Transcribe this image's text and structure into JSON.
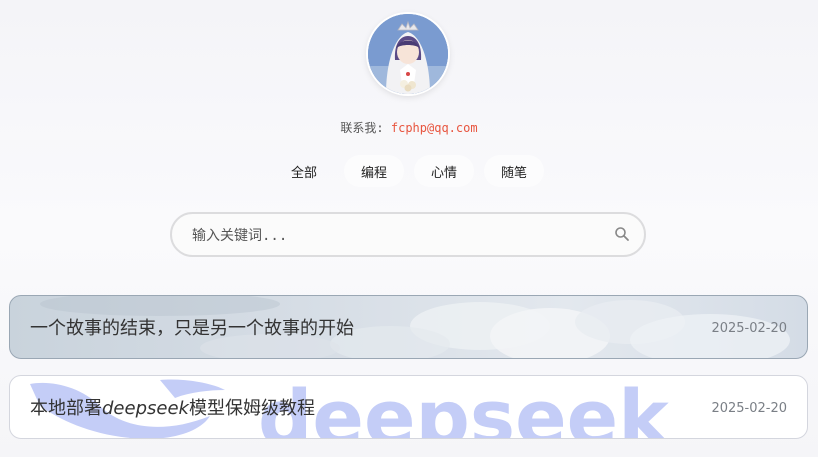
{
  "contact": {
    "label": "联系我:",
    "email": "fcphp@qq.com"
  },
  "tabs": [
    {
      "label": "全部",
      "active": true
    },
    {
      "label": "编程",
      "active": false
    },
    {
      "label": "心情",
      "active": false
    },
    {
      "label": "随笔",
      "active": false
    }
  ],
  "search": {
    "placeholder": "输入关键词...",
    "icon": "search-icon"
  },
  "posts": [
    {
      "title": "一个故事的结束，只是另一个故事的开始",
      "date": "2025-02-20"
    },
    {
      "title_prefix": "本地部署",
      "title_italic": "deepseek",
      "title_suffix": "模型保姆级教程",
      "date": "2025-02-20",
      "watermark": "deepseek"
    }
  ],
  "colors": {
    "email": "#e8553f",
    "watermark": "#c4cdf7"
  }
}
